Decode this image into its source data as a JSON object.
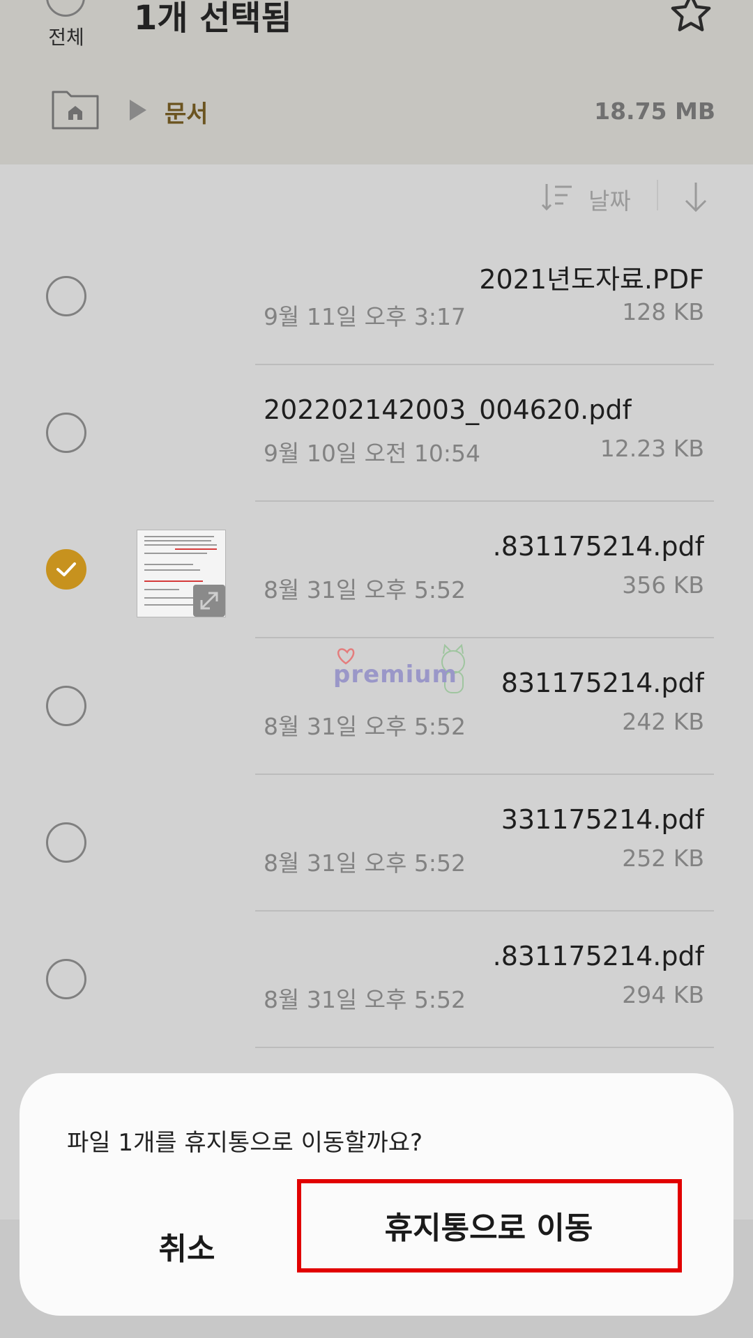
{
  "header": {
    "select_all_label": "전체",
    "title": "1개 선택됨",
    "breadcrumb": "문서",
    "storage_size": "18.75 MB"
  },
  "sort": {
    "label": "날짜"
  },
  "files": [
    {
      "name": "2021년도자료.PDF",
      "date": "9월 11일 오후 3:17",
      "size": "128 KB",
      "checked": false
    },
    {
      "name": "202202142003_004620.pdf",
      "date": "9월 10일 오전 10:54",
      "size": "12.23 KB",
      "checked": false
    },
    {
      "name": ".831175214.pdf",
      "date": "8월 31일 오후 5:52",
      "size": "356 KB",
      "checked": true
    },
    {
      "name": "831175214.pdf",
      "date": "8월 31일 오후 5:52",
      "size": "242 KB",
      "checked": false
    },
    {
      "name": "331175214.pdf",
      "date": "8월 31일 오후 5:52",
      "size": "252 KB",
      "checked": false
    },
    {
      "name": ".831175214.pdf",
      "date": "8월 31일 오후 5:52",
      "size": "294 KB",
      "checked": false
    }
  ],
  "watermark": {
    "text": "premium"
  },
  "dialog": {
    "message": "파일 1개를 휴지통으로 이동할까요?",
    "cancel_label": "취소",
    "confirm_label": "휴지통으로 이동"
  },
  "colors": {
    "accent": "#c7921e",
    "highlight": "#e10000"
  },
  "icons": [
    "star-icon",
    "home-icon",
    "sort-icon",
    "arrow-down-icon",
    "check-icon",
    "expand-icon"
  ]
}
